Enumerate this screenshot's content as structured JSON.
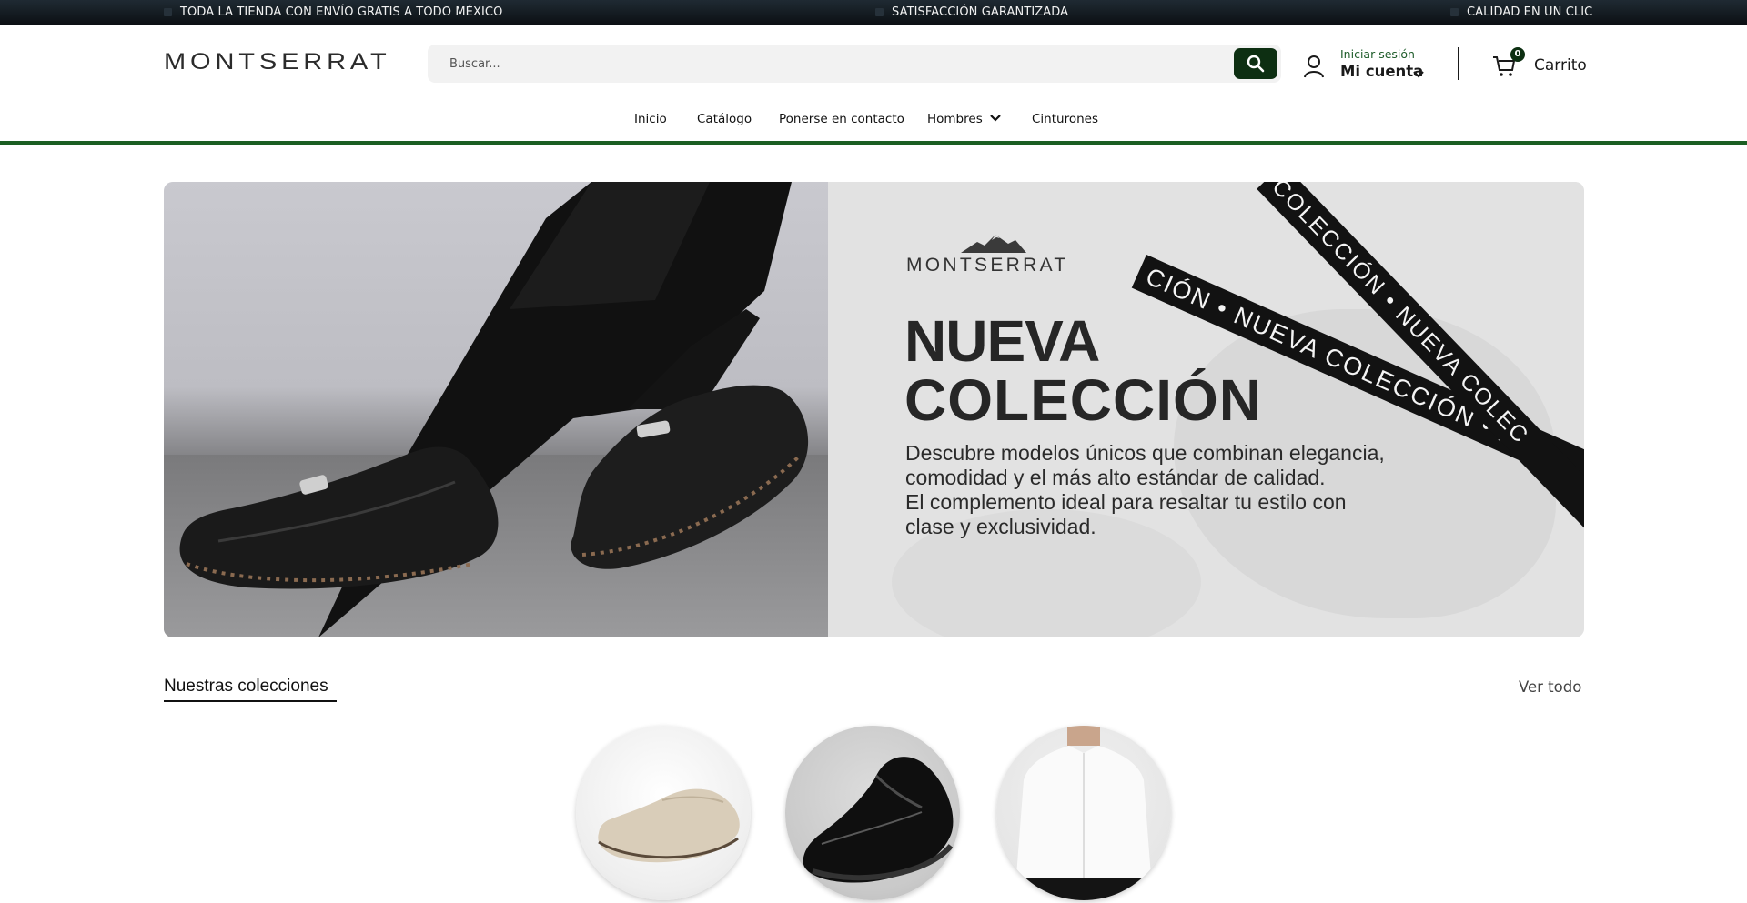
{
  "announcement": {
    "msg1": "TODA LA TIENDA CON ENVÍO GRATIS A TODO MÉXICO",
    "msg2": "SATISFACCIÓN GARANTIZADA",
    "msg3": "CALIDAD EN UN CLIC"
  },
  "header": {
    "logo": "MONTSERRAT",
    "search_placeholder": "Buscar...",
    "account_small": "Iniciar sesión",
    "account_big": "Mi cuenta",
    "cart_count": "0",
    "cart_label": "Carrito"
  },
  "nav": {
    "items": [
      "Inicio",
      "Catálogo",
      "Ponerse en contacto",
      "Hombres",
      "Cinturones"
    ]
  },
  "hero": {
    "logo": "MONTSERRAT",
    "title_line1": "NUEVA",
    "title_line2": "COLECCIÓN",
    "desc_line1": "Descubre modelos únicos que combinan elegancia,",
    "desc_line2": "comodidad y el más alto estándar de calidad.",
    "desc_line3": "El complemento ideal para resaltar tu estilo con",
    "desc_line4": "clase y exclusividad.",
    "ribbon1": "CIÓN • NUEVA COLECCIÓN • NU",
    "ribbon2": "COLECCIÓN • NUEVA COLEC"
  },
  "collections": {
    "title": "Nuestras colecciones",
    "view_all": "Ver todo"
  },
  "colors": {
    "brand_green": "#0d2f12",
    "accent_green": "#1b5e22",
    "topbar": "#0b0f12"
  }
}
